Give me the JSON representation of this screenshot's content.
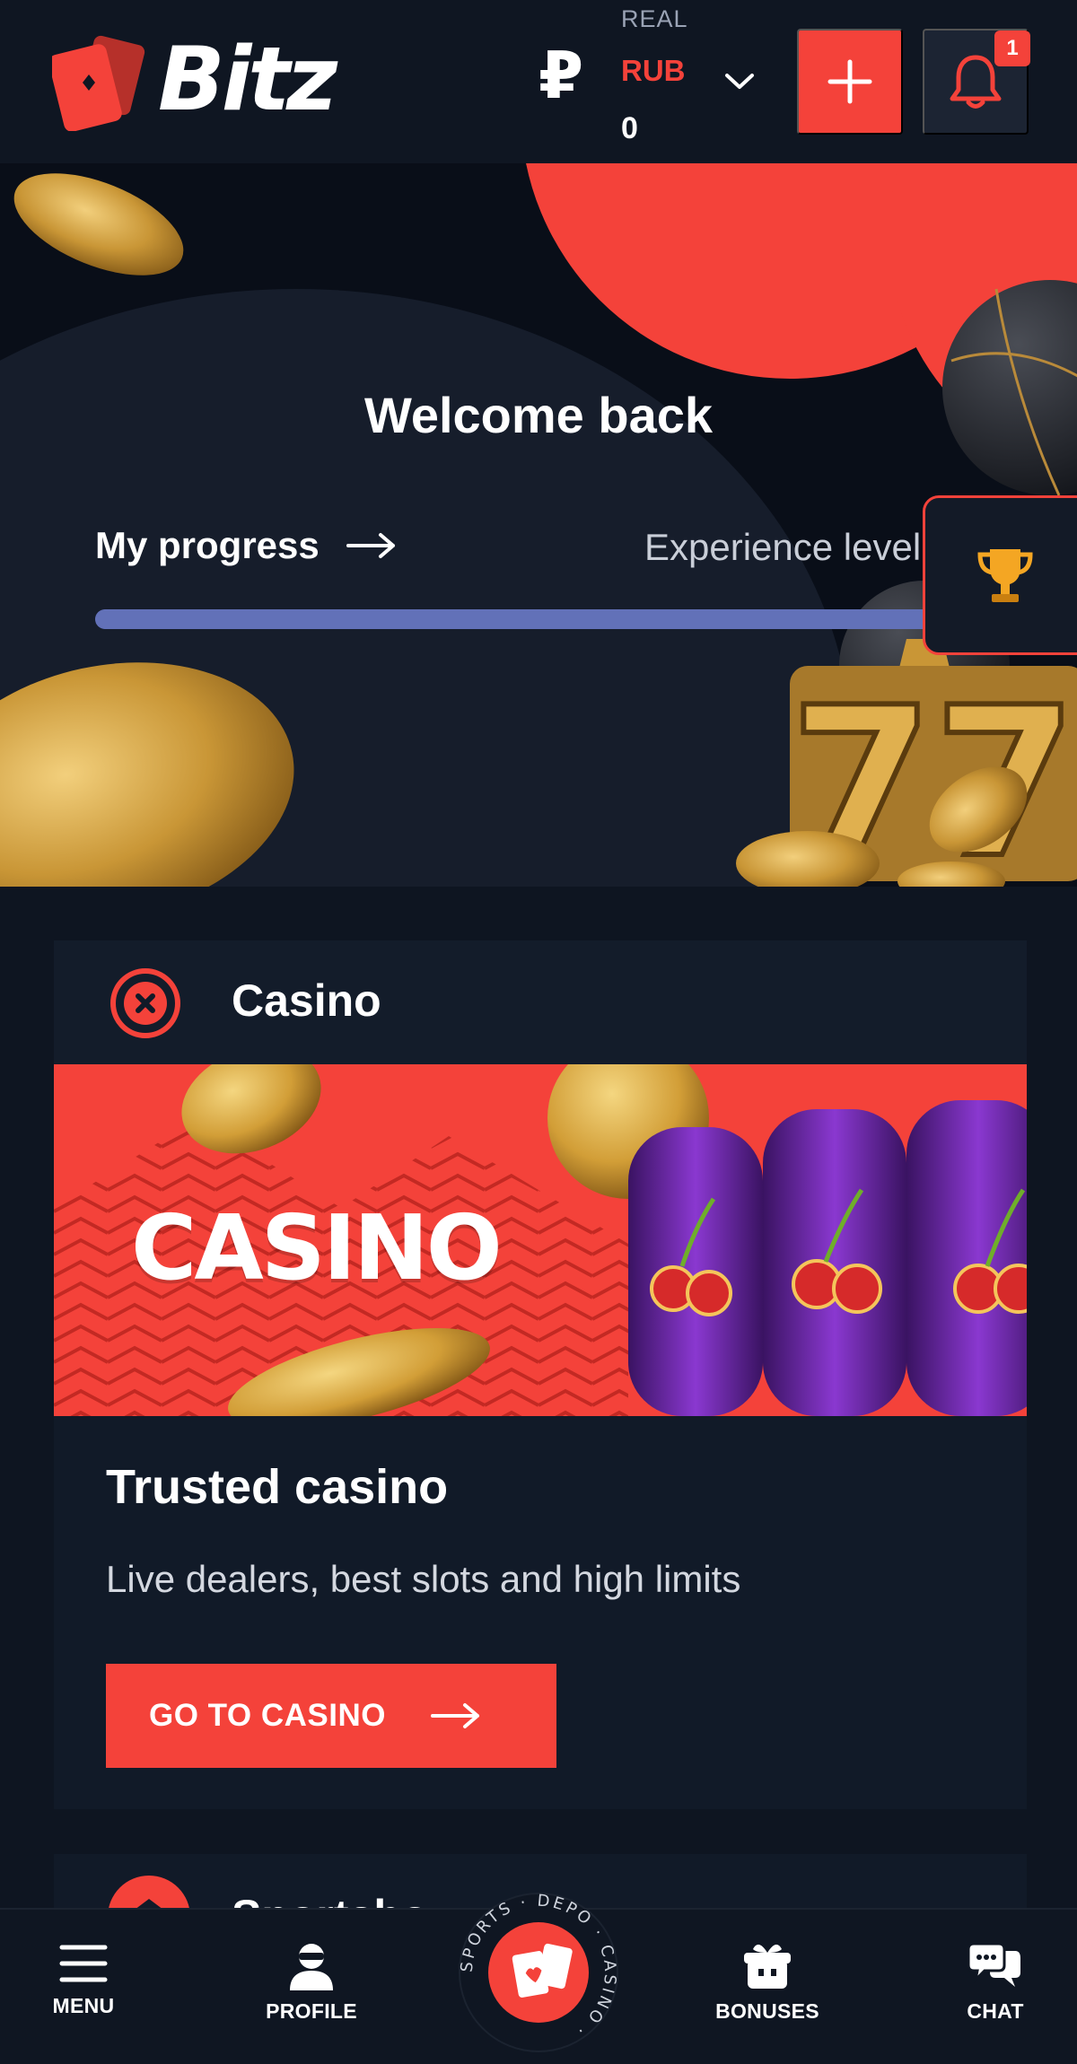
{
  "header": {
    "logo_text": "Bitz",
    "currency_symbol": "₽",
    "account_mode": "REAL",
    "currency": "RUB",
    "balance": "0",
    "notifications_count": "1"
  },
  "hero": {
    "title": "Welcome back",
    "progress_label": "My progress",
    "experience_label": "Experience level",
    "progress_fraction": 1.0
  },
  "casino_card": {
    "title": "Casino",
    "banner_word": "CASINO",
    "heading": "Trusted casino",
    "description": "Live dealers, best slots and high limits",
    "cta_label": "GO TO CASINO"
  },
  "next_card": {
    "title": "Sportsbo"
  },
  "bottom_nav": {
    "menu": "MENU",
    "profile": "PROFILE",
    "center_ring_text": "SPORTS · DEPO · CASINO ·",
    "bonuses": "BONUSES",
    "chat": "CHAT"
  },
  "colors": {
    "accent": "#f4423a",
    "background": "#0e1521",
    "card": "#111a28",
    "progress": "#4c5a9a"
  },
  "icons": [
    "currency-ruble-icon",
    "chevron-down-icon",
    "plus-icon",
    "bell-icon",
    "trophy-icon",
    "casino-chip-icon",
    "arrow-right-icon",
    "hamburger-icon",
    "profile-icon",
    "cards-icon",
    "gift-icon",
    "chat-icon"
  ]
}
